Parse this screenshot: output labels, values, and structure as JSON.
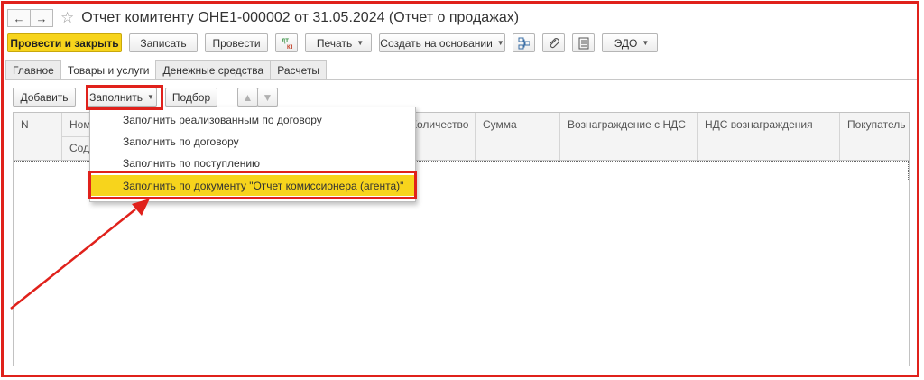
{
  "window": {
    "title": "Отчет комитенту ОНЕ1-000002 от 31.05.2024 (Отчет о продажах)",
    "back_icon": "←",
    "forward_icon": "→",
    "star_icon": "☆"
  },
  "toolbar": {
    "post_close": "Провести и закрыть",
    "save": "Записать",
    "post": "Провести",
    "dtkt_label": "ДТ КТ",
    "print": "Печать",
    "create_based": "Создать на основании",
    "edo": "ЭДО"
  },
  "tabs": [
    "Главное",
    "Товары и услуги",
    "Денежные средства",
    "Расчеты"
  ],
  "subtoolbar": {
    "add": "Добавить",
    "fill": "Заполнить",
    "selection": "Подбор"
  },
  "table": {
    "columns": {
      "n": "N",
      "nom": "Номенклатура",
      "content": "Содержание",
      "qty": "Количество",
      "sum": "Сумма",
      "reward_vat": "Вознаграждение с НДС",
      "vat_reward": "НДС вознаграждения",
      "buyer": "Покупатель"
    }
  },
  "fill_menu": {
    "items": [
      "Заполнить реализованным по договору",
      "Заполнить по договору",
      "Заполнить по поступлению",
      "Заполнить по документу \"Отчет комиссионера (агента)\""
    ],
    "selected_index": 3
  },
  "colors": {
    "accent_yellow": "#f7d41c",
    "highlight_red": "#e0211b"
  }
}
